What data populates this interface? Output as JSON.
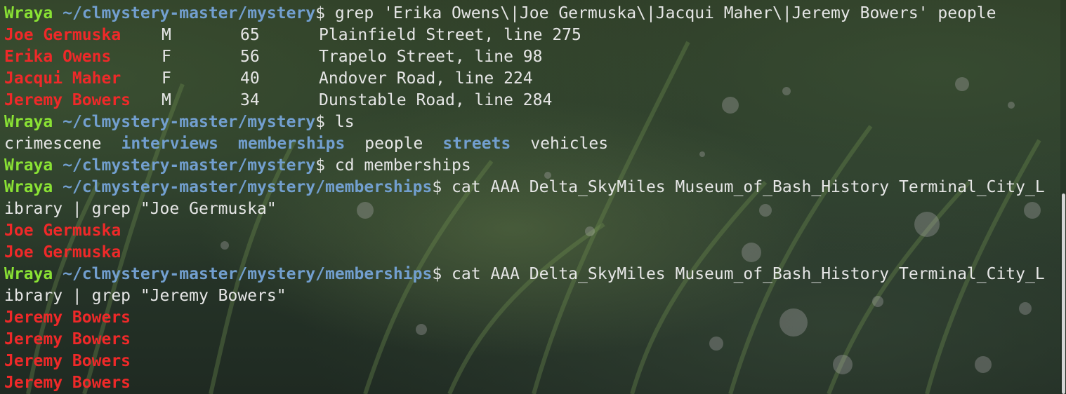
{
  "prompt": {
    "user": "Wraya",
    "path_mystery": "~/clmystery-master/mystery",
    "path_memberships": "~/clmystery-master/mystery/memberships",
    "symbol": "$"
  },
  "commands": {
    "grep_people": " grep 'Erika Owens\\|Joe Germuska\\|Jacqui Maher\\|Jeremy Bowers' people",
    "ls": " ls",
    "cd": " cd memberships",
    "cat_joe_part1": " cat AAA Delta_SkyMiles Museum_of_Bash_History Terminal_City_L",
    "cat_joe_part2": "ibrary | grep \"Joe Germuska\"",
    "cat_jeremy_part1": " cat AAA Delta_SkyMiles Museum_of_Bash_History Terminal_City_L",
    "cat_jeremy_part2": "ibrary | grep \"Jeremy Bowers\""
  },
  "people_results": [
    {
      "name": "Joe Germuska",
      "sex": "M",
      "age": "65",
      "address": "Plainfield Street, line 275"
    },
    {
      "name": "Erika Owens",
      "sex": "F",
      "age": "56",
      "address": "Trapelo Street, line 98"
    },
    {
      "name": "Jacqui Maher",
      "sex": "F",
      "age": "40",
      "address": "Andover Road, line 224"
    },
    {
      "name": "Jeremy Bowers",
      "sex": "M",
      "age": "34",
      "address": "Dunstable Road, line 284"
    }
  ],
  "ls_output": [
    {
      "name": "crimescene",
      "kind": "file"
    },
    {
      "name": "interviews",
      "kind": "dir"
    },
    {
      "name": "memberships",
      "kind": "dir"
    },
    {
      "name": "people",
      "kind": "file"
    },
    {
      "name": "streets",
      "kind": "dir"
    },
    {
      "name": "vehicles",
      "kind": "file"
    }
  ],
  "joe_matches": [
    "Joe Germuska",
    "Joe Germuska"
  ],
  "jeremy_matches": [
    "Jeremy Bowers",
    "Jeremy Bowers",
    "Jeremy Bowers",
    "Jeremy Bowers"
  ],
  "colors": {
    "prompt_user": "#8ae234",
    "prompt_path": "#729fcf",
    "match": "#ef2929",
    "text": "#e6e6e6",
    "directory": "#729fcf"
  }
}
